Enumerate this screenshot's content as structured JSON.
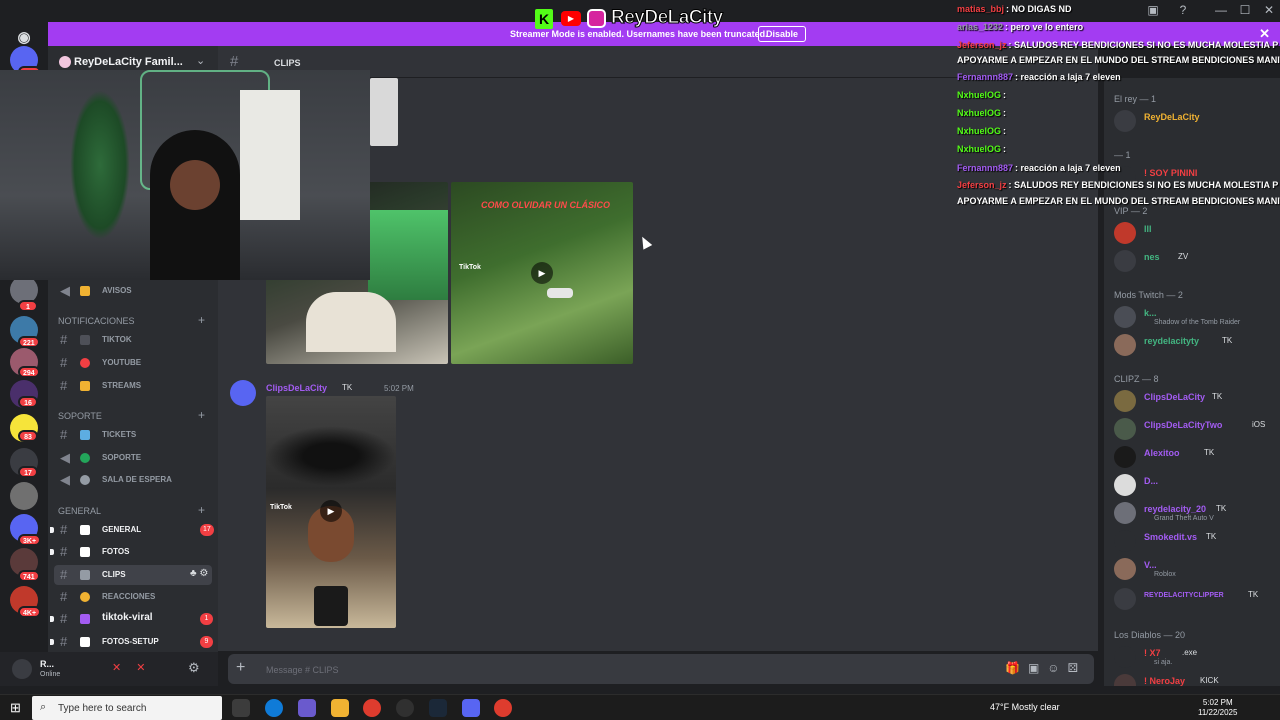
{
  "window": {
    "minimize": "—",
    "maximize": "☐",
    "close": "✕",
    "inbox_icon": "inbox-icon",
    "help_icon": "help-icon"
  },
  "banner": {
    "text": "Streamer Mode is enabled. Usernames have been truncated.",
    "button": "Disable",
    "close": "✕",
    "color": "#a33cf2"
  },
  "stream_logo": {
    "brand": "ReyDeLaCity",
    "k": "K",
    "yt": "▶"
  },
  "server": {
    "name": "ReyDeLaCity Famil...",
    "chevron": "⌄"
  },
  "rail": {
    "badges": [
      "1K+",
      "1",
      "221",
      "294",
      "16",
      "83",
      "17",
      "3K+",
      "741",
      "4K+"
    ]
  },
  "sidebar": {
    "top_channel": {
      "label": "AVISOS"
    },
    "categories": [
      {
        "label": "NOTIFICACIONES",
        "channels": [
          {
            "label": "TIKTOK",
            "emoji_color": "#4e5058"
          },
          {
            "label": "YOUTUBE",
            "emoji_color": "#f23f43"
          },
          {
            "label": "STREAMS",
            "emoji_color": "#f0b232"
          }
        ]
      },
      {
        "label": "SOPORTE",
        "channels": [
          {
            "label": "TICKETS",
            "emoji_color": "#5dade2"
          },
          {
            "label": "SOPORTE",
            "emoji_color": "#23a55a"
          },
          {
            "label": "SALA DE ESPERA",
            "emoji_color": "#949ba4"
          }
        ]
      },
      {
        "label": "GENERAL",
        "channels": [
          {
            "label": "GENERAL",
            "emoji_color": "#ffffff",
            "badge": "17"
          },
          {
            "label": "FOTOS",
            "emoji_color": "#ffffff"
          },
          {
            "label": "CLIPS",
            "emoji_color": "#949ba4",
            "active": true
          },
          {
            "label": "REACCIONES",
            "emoji_color": "#f0b232"
          },
          {
            "label": "tiktok-viral",
            "emoji_color": "#a35cf2",
            "badge": "1"
          },
          {
            "label": "FOTOS-SETUP",
            "emoji_color": "#ffffff",
            "badge": "9"
          }
        ]
      }
    ]
  },
  "channel_header": {
    "hash": "#",
    "title": "CLIPS"
  },
  "chat": {
    "clip_title": "COMO OLVIDAR UN CLÁSICO",
    "tiktok": "TikTok",
    "message": {
      "author": "ClipsDeLaCity",
      "tag": "TK",
      "time": "5:02 PM"
    }
  },
  "composer": {
    "plus": "+",
    "placeholder": "Message # CLIPS"
  },
  "user": {
    "name": "R...",
    "status": "Online",
    "mic_icons": "✕ ✕ ⚙"
  },
  "members": {
    "groups": [
      {
        "label": "El rey — 1",
        "members": [
          {
            "name": "ReyDeLaCity",
            "color": "#f0b232"
          }
        ]
      },
      {
        "label": "— 1",
        "members": [
          {
            "name": "! SOY PININI",
            "color": "#f23f43"
          }
        ]
      },
      {
        "label": "VIP — 2",
        "members": [
          {
            "name": "lll",
            "color": "#43b581"
          },
          {
            "name": "nes",
            "color": "#43b581",
            "tag": "ZV"
          }
        ]
      },
      {
        "label": "Mods Twitch — 2",
        "members": [
          {
            "name": "k...",
            "color": "#43b581",
            "sub": "Shadow of the Tomb Raider"
          },
          {
            "name": "reydelacityty",
            "color": "#43b581",
            "tag": "TK"
          }
        ]
      },
      {
        "label": "CLIPZ — 8",
        "members": [
          {
            "name": "ClipsDeLaCity",
            "color": "#a35cf2",
            "tag": "TK"
          },
          {
            "name": "ClipsDeLaCityTwo",
            "color": "#a35cf2",
            "tag": "iOS"
          },
          {
            "name": "Alexitoo",
            "color": "#a35cf2",
            "tag": "TK"
          },
          {
            "name": "D...",
            "color": "#a35cf2"
          },
          {
            "name": "reydelacity_20",
            "color": "#a35cf2",
            "tag": "TK",
            "sub": "Grand Theft Auto V"
          },
          {
            "name": "Smokedit.vs",
            "color": "#a35cf2",
            "tag": "TK"
          },
          {
            "name": "V...",
            "color": "#a35cf2",
            "sub": "Roblox"
          },
          {
            "name": "REYDELACITYCLIPPER",
            "color": "#a35cf2",
            "tag": "TK"
          }
        ]
      },
      {
        "label": "Los Diablos — 20",
        "members": [
          {
            "name": "! X7",
            "color": "#f23f43",
            "tag": ".exe",
            "sub": "si aja."
          },
          {
            "name": "! NeroJay",
            "color": "#f23f43",
            "tag": "KICK"
          }
        ]
      }
    ]
  },
  "overlay_chat": [
    {
      "user": "matias_bbj",
      "user_color": "#f23f43",
      "text": ": NO DIGAS ND"
    },
    {
      "user": "arias_1232",
      "user_color": "#949ba4",
      "text": ": pero ve lo entero"
    },
    {
      "user": "Jeferson_jz",
      "user_color": "#f23f43",
      "text": ": SALUDOS REY BENDICIONES SI NO ES MUCHA MOLESTIA P"
    },
    {
      "user": "",
      "user_color": "#ffffff",
      "text": "APOYARME A EMPEZAR EN EL MUNDO DEL STREAM BENDICIONES MANIT"
    },
    {
      "user": "Fernannn887",
      "user_color": "#a35cf2",
      "text": ": reacción a laja 7 eleven"
    },
    {
      "user": "NxhuelOG",
      "user_color": "#53fc18",
      "text": ":"
    },
    {
      "user": "NxhuelOG",
      "user_color": "#53fc18",
      "text": ":"
    },
    {
      "user": "NxhuelOG",
      "user_color": "#53fc18",
      "text": ":"
    },
    {
      "user": "NxhuelOG",
      "user_color": "#53fc18",
      "text": ":"
    },
    {
      "user": "Fernannn887",
      "user_color": "#a35cf2",
      "text": ": reacción a laja 7 eleven"
    },
    {
      "user": "Jeferson_jz",
      "user_color": "#f23f43",
      "text": ": SALUDOS REY BENDICIONES SI NO ES MUCHA MOLESTIA P"
    },
    {
      "user": "",
      "user_color": "#ffffff",
      "text": "APOYARME A EMPEZAR EN EL MUNDO DEL STREAM BENDICIONES MANIT"
    }
  ],
  "taskbar": {
    "search_placeholder": "Type here to search",
    "weather": "47°F  Mostly clear",
    "time": "5:02 PM",
    "date": "11/22/2025"
  }
}
